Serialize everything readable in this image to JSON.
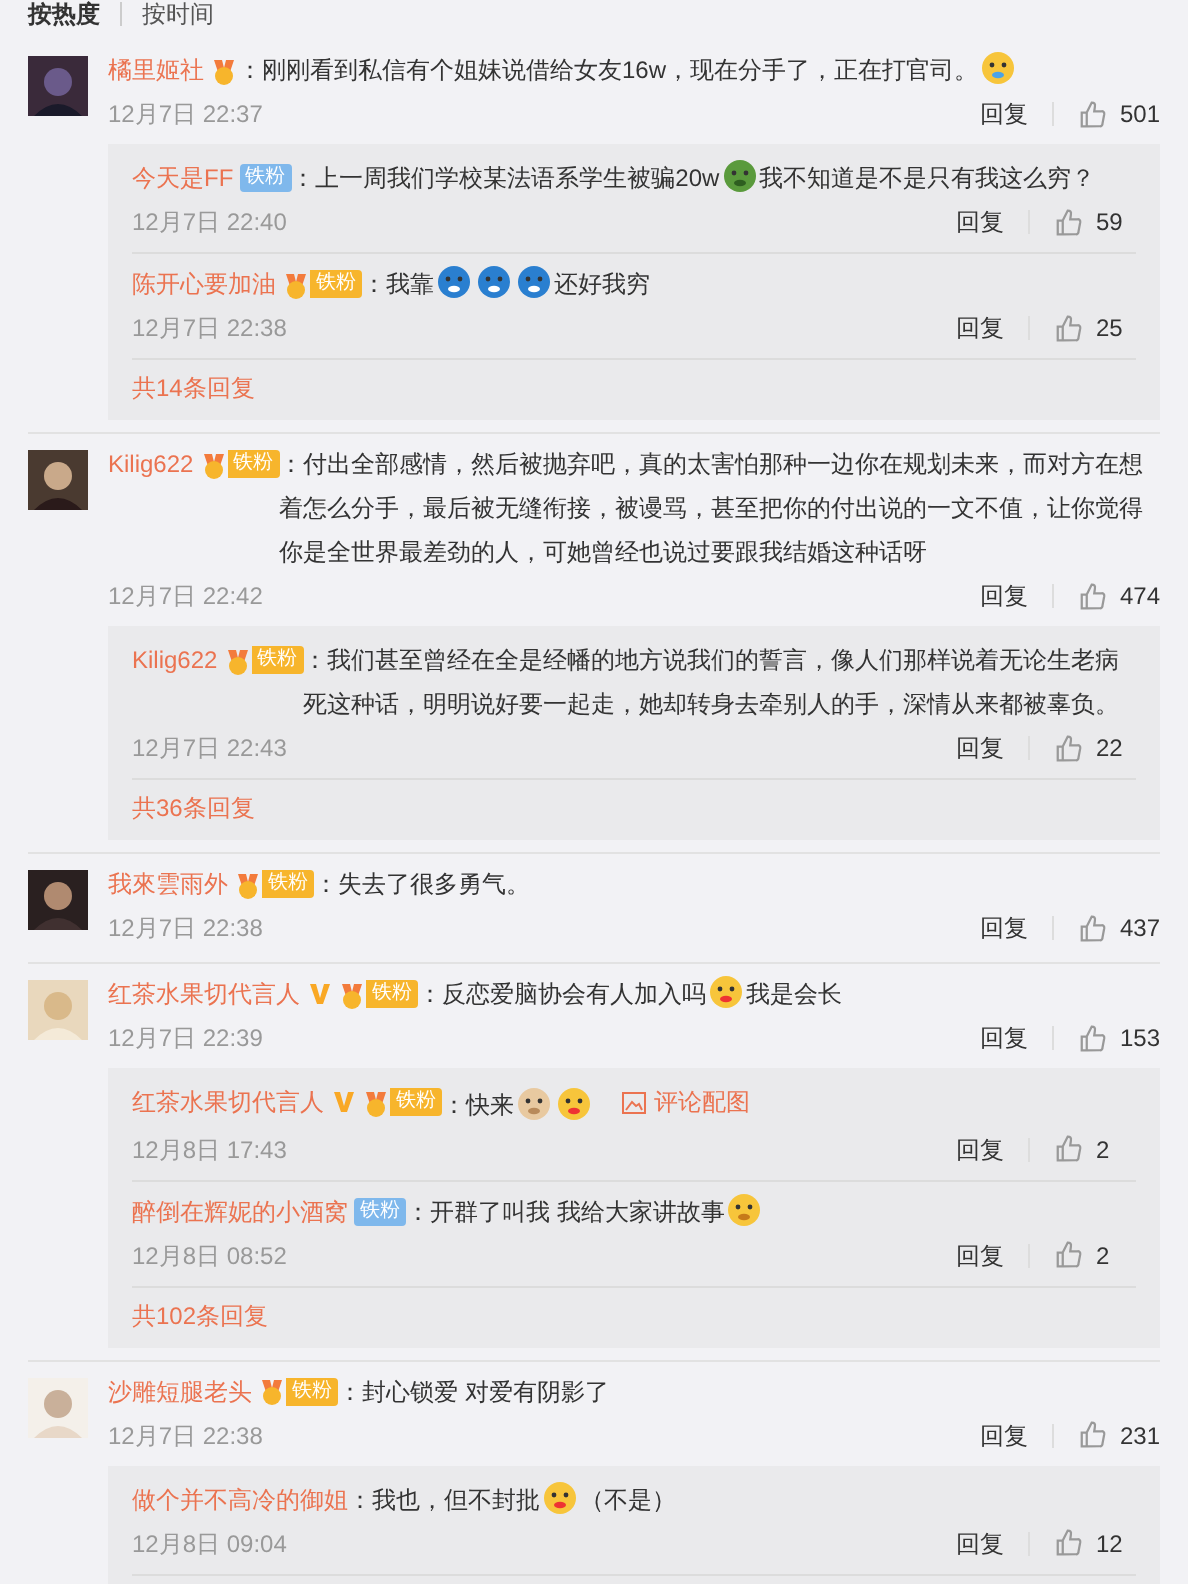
{
  "sort_tabs": [
    {
      "label": "按热度",
      "selected": true
    },
    {
      "label": "按时间",
      "selected": false
    }
  ],
  "comments": [
    {
      "user": "橘里姬社",
      "verified": false,
      "badge": {
        "kind": "level"
      },
      "content": [
        {
          "kind": "text",
          "text": "：刚刚看到私信有个姐妹说借给女友16w，现在分手了，正在打官司。"
        },
        {
          "kind": "cry"
        }
      ],
      "time": "12月7日 22:37",
      "reply": "回复",
      "likes": "501",
      "replies": [
        {
          "user": "今天是FF",
          "verified": false,
          "badge": {
            "kind": "plain",
            "label": "铁粉"
          },
          "content": [
            {
              "kind": "text",
              "text": "：上一周我们学校某法语系学生被骗20w"
            },
            {
              "kind": "green"
            },
            {
              "kind": "text",
              "text": "我不知道是不是只有我这么穷？"
            }
          ],
          "time": "12月7日 22:40",
          "reply": "回复",
          "likes": "59"
        },
        {
          "user": "陈开心要加油",
          "verified": false,
          "badge": {
            "kind": "level",
            "label": "铁粉"
          },
          "content": [
            {
              "kind": "text",
              "text": "：我靠"
            },
            {
              "kind": "shock"
            },
            {
              "kind": "shock"
            },
            {
              "kind": "shock"
            },
            {
              "kind": "text",
              "text": "还好我穷"
            }
          ],
          "time": "12月7日 22:38",
          "reply": "回复",
          "likes": "25"
        }
      ],
      "more": "共14条回复"
    },
    {
      "user": "Kilig622",
      "verified": false,
      "badge": {
        "kind": "level",
        "label": "铁粉"
      },
      "content": [
        {
          "kind": "text",
          "text": "：付出全部感情，然后被抛弃吧，真的太害怕那种一边你在规划未来，而对方在想着怎么分手，最后被无缝衔接，被谩骂，甚至把你的付出说的一文不值，让你觉得你是全世界最差劲的人，可她曾经也说过要跟我结婚这种话呀"
        }
      ],
      "time": "12月7日 22:42",
      "reply": "回复",
      "likes": "474",
      "replies": [
        {
          "user": "Kilig622",
          "verified": false,
          "badge": {
            "kind": "level",
            "label": "铁粉"
          },
          "content": [
            {
              "kind": "text",
              "text": "：我们甚至曾经在全是经幡的地方说我们的誓言，像人们那样说着无论生老病死这种话，明明说好要一起走，她却转身去牵别人的手，深情从来都被辜负。"
            }
          ],
          "time": "12月7日 22:43",
          "reply": "回复",
          "likes": "22"
        }
      ],
      "more": "共36条回复"
    },
    {
      "user": "我來雲雨外",
      "verified": false,
      "badge": {
        "kind": "level",
        "label": "铁粉"
      },
      "content": [
        {
          "kind": "text",
          "text": "：失去了很多勇气。"
        }
      ],
      "time": "12月7日 22:38",
      "reply": "回复",
      "likes": "437"
    },
    {
      "user": "红茶水果切代言人",
      "verified": true,
      "badge": {
        "kind": "level",
        "label": "铁粉"
      },
      "content": [
        {
          "kind": "text",
          "text": "：反恋爱脑协会有人加入吗"
        },
        {
          "kind": "kiss"
        },
        {
          "kind": "text",
          "text": "我是会长"
        }
      ],
      "time": "12月7日 22:39",
      "reply": "回复",
      "likes": "153",
      "replies": [
        {
          "user": "红茶水果切代言人",
          "verified": true,
          "badge": {
            "kind": "level",
            "label": "铁粉"
          },
          "content": [
            {
              "kind": "text",
              "text": "：快来"
            },
            {
              "kind": "fist"
            },
            {
              "kind": "kiss"
            }
          ],
          "image_link": "评论配图",
          "time": "12月8日 17:43",
          "reply": "回复",
          "likes": "2"
        },
        {
          "user": "醉倒在辉妮的小酒窝",
          "verified": false,
          "badge": {
            "kind": "plain",
            "label": "铁粉"
          },
          "content": [
            {
              "kind": "text",
              "text": "：开群了叫我 我给大家讲故事"
            },
            {
              "kind": "smile"
            }
          ],
          "time": "12月8日 08:52",
          "reply": "回复",
          "likes": "2"
        }
      ],
      "more": "共102条回复"
    },
    {
      "user": "沙雕短腿老头",
      "verified": false,
      "badge": {
        "kind": "level",
        "label": "铁粉"
      },
      "content": [
        {
          "kind": "text",
          "text": "：封心锁爱 对爱有阴影了"
        }
      ],
      "time": "12月7日 22:38",
      "reply": "回复",
      "likes": "231",
      "replies": [
        {
          "user": "做个并不高冷的御姐",
          "verified": false,
          "content": [
            {
              "kind": "text",
              "text": "：我也，但不封批"
            },
            {
              "kind": "kiss"
            },
            {
              "kind": "text",
              "text": "（不是）"
            }
          ],
          "time": "12月8日 09:04",
          "reply": "回复",
          "likes": "12"
        }
      ]
    }
  ]
}
